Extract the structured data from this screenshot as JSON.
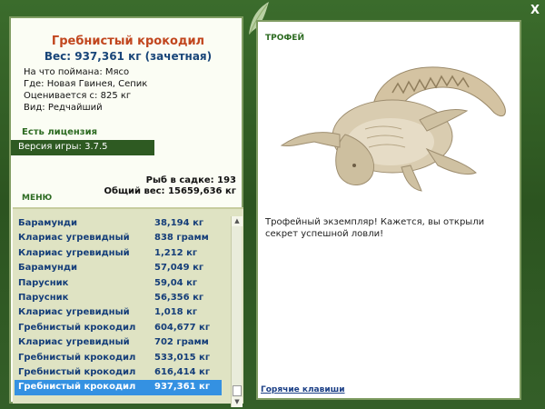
{
  "catch": {
    "title": "Гребнистый крокодил",
    "weight": "Вес: 937,361 кг (зачетная)",
    "bait": "На что поймана: Мясо",
    "place": "Где: Новая Гвинея, Сепик",
    "value": "Оценивается с: 825 кг",
    "rarity": "Вид: Редчайший"
  },
  "license_text": "Есть лицензия",
  "version_text": "Версия игры: 3.7.5",
  "menu_label": "МЕНЮ",
  "summary": {
    "fish_count": "Рыб в садке: 193",
    "total_weight": "Общий вес: 15659,636 кг"
  },
  "fish_list": [
    {
      "name": "Барамунди",
      "weight": "38,194 кг"
    },
    {
      "name": "Клариас угревидный",
      "weight": "838 грамм"
    },
    {
      "name": "Клариас угревидный",
      "weight": "1,212 кг"
    },
    {
      "name": "Барамунди",
      "weight": "57,049 кг"
    },
    {
      "name": "Парусник",
      "weight": "59,04 кг"
    },
    {
      "name": "Парусник",
      "weight": "56,356 кг"
    },
    {
      "name": "Клариас угревидный",
      "weight": "1,018 кг"
    },
    {
      "name": "Гребнистый крокодил",
      "weight": "604,677 кг"
    },
    {
      "name": "Клариас угревидный",
      "weight": "702 грамм"
    },
    {
      "name": "Гребнистый крокодил",
      "weight": "533,015 кг"
    },
    {
      "name": "Гребнистый крокодил",
      "weight": "616,414 кг"
    },
    {
      "name": "Гребнистый крокодил",
      "weight": "937,361 кг"
    }
  ],
  "trophy": {
    "label": "ТРОФЕЙ",
    "text": "Трофейный экземпляр! Кажется, вы открыли секрет успешной ловли!",
    "image_icon": "crocodile-icon"
  },
  "hotkeys_label": "Горячие клавиши",
  "close_label": "X",
  "colors": {
    "frame": "#2f5a23",
    "title": "#c1461e",
    "weight": "#184578",
    "selection": "#3491e2",
    "list_bg": "#dfe3c3"
  }
}
